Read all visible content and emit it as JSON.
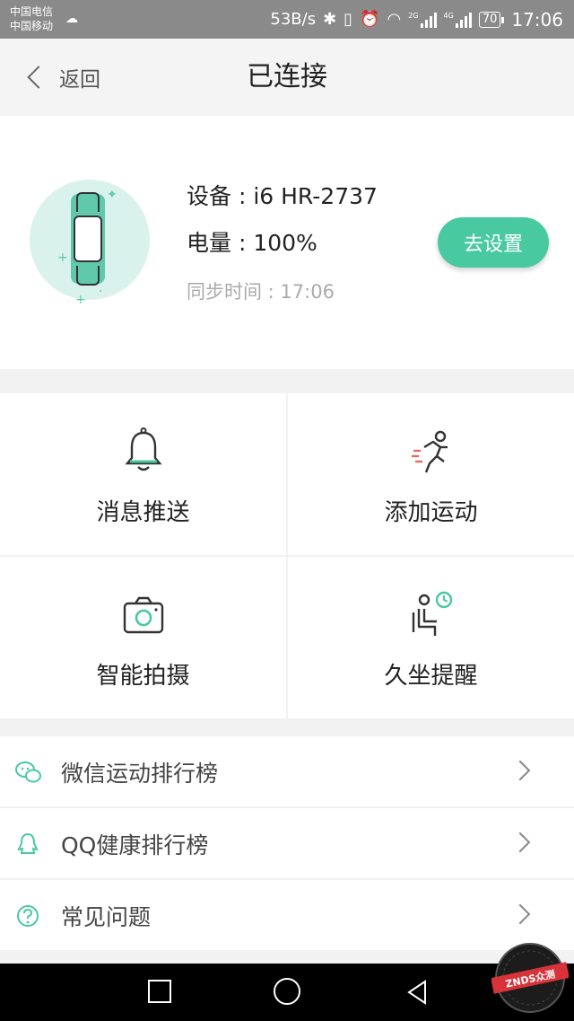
{
  "status_bar": {
    "carrier_1": "中国电信",
    "carrier_2": "中国移动",
    "net_speed": "53B/s",
    "net_type_1": "2G",
    "net_type_2": "4G",
    "battery": "70",
    "time": "17:06"
  },
  "header": {
    "back_label": "返回",
    "title": "已连接"
  },
  "device": {
    "name_line": "设备 : i6 HR-2737",
    "battery_line": "电量 : 100%",
    "sync_line": "同步时间 : 17:06",
    "settings_button": "去设置",
    "accent_color": "#49c9a0"
  },
  "features": [
    {
      "label": "消息推送",
      "icon": "bell-icon"
    },
    {
      "label": "添加运动",
      "icon": "running-icon"
    },
    {
      "label": "智能拍摄",
      "icon": "camera-icon"
    },
    {
      "label": "久坐提醒",
      "icon": "sedentary-reminder-icon"
    }
  ],
  "list": [
    {
      "label": "微信运动排行榜",
      "icon": "wechat-icon"
    },
    {
      "label": "QQ健康排行榜",
      "icon": "qq-icon"
    },
    {
      "label": "常见问题",
      "icon": "question-icon"
    }
  ],
  "watermark": {
    "text": "ZNDS众测"
  }
}
